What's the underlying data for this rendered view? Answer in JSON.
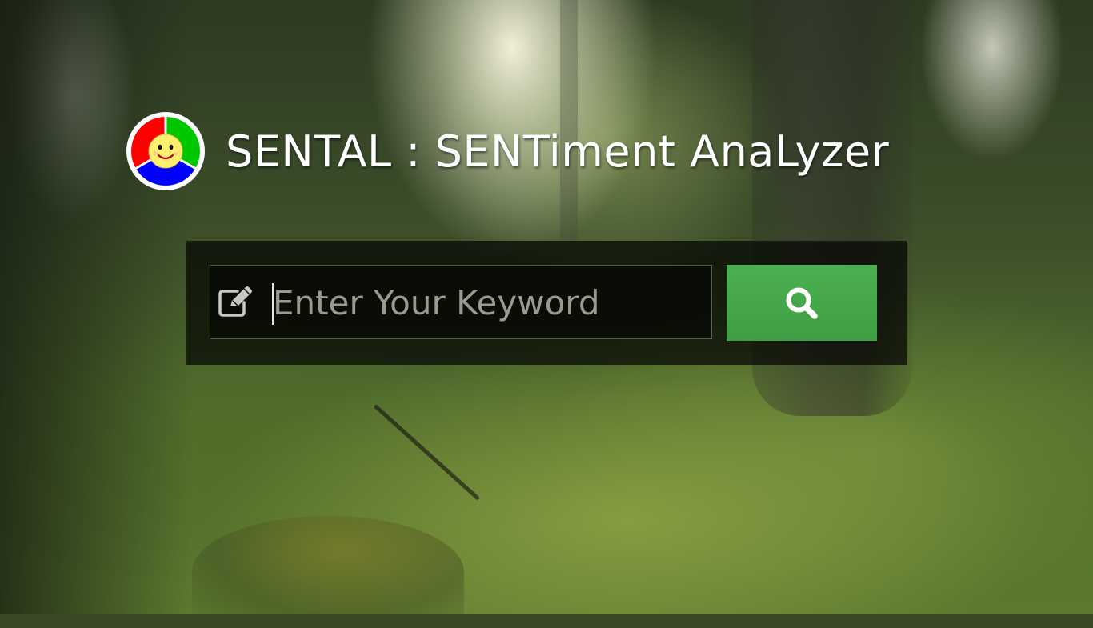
{
  "app": {
    "title": "SENTAL : SENTiment AnaLyzer",
    "logo_icon": "smiley-face-logo-icon",
    "logo_colors": [
      "#ff0000",
      "#00cc00",
      "#0000ff",
      "#ffff66"
    ]
  },
  "search": {
    "placeholder": "Enter Your Keyword",
    "value": "",
    "input_icon": "edit-pencil-icon",
    "button_icon": "search-icon",
    "button_color": "#43a047"
  }
}
